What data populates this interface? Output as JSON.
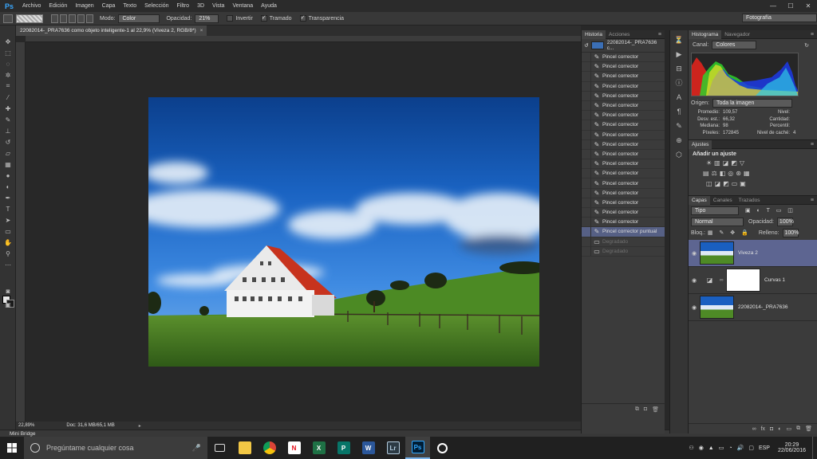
{
  "app": {
    "logo": "Ps"
  },
  "menu": [
    "Archivo",
    "Edición",
    "Imagen",
    "Capa",
    "Texto",
    "Selección",
    "Filtro",
    "3D",
    "Vista",
    "Ventana",
    "Ayuda"
  ],
  "options_bar": {
    "mode_label": "Modo:",
    "mode_value": "Color",
    "opacity_label": "Opacidad:",
    "opacity_value": "21%",
    "invert_label": "Invertir",
    "stroke_label": "Tramado",
    "transparency_label": "Transparencia",
    "workspace": "Fotografía"
  },
  "document": {
    "tab_title": "22082014-_PRA7636 como objeto inteligente-1 al 22,9% (Viveza 2, RGB/8*)",
    "zoom": "22,89%",
    "doc_size": "Doc: 31,6 MB/65,1 MB"
  },
  "mini_bridge": "Mini Bridge",
  "history": {
    "tabs": [
      "Historia",
      "Acciones"
    ],
    "snapshot": "22082014-_PRA7636 c...",
    "items": [
      {
        "label": "Pincel corrector",
        "state": "normal"
      },
      {
        "label": "Pincel corrector",
        "state": "normal"
      },
      {
        "label": "Pincel corrector",
        "state": "normal"
      },
      {
        "label": "Pincel corrector",
        "state": "normal"
      },
      {
        "label": "Pincel corrector",
        "state": "normal"
      },
      {
        "label": "Pincel corrector",
        "state": "normal"
      },
      {
        "label": "Pincel corrector",
        "state": "normal"
      },
      {
        "label": "Pincel corrector",
        "state": "normal"
      },
      {
        "label": "Pincel corrector",
        "state": "normal"
      },
      {
        "label": "Pincel corrector",
        "state": "normal"
      },
      {
        "label": "Pincel corrector",
        "state": "normal"
      },
      {
        "label": "Pincel corrector",
        "state": "normal"
      },
      {
        "label": "Pincel corrector",
        "state": "normal"
      },
      {
        "label": "Pincel corrector",
        "state": "normal"
      },
      {
        "label": "Pincel corrector",
        "state": "normal"
      },
      {
        "label": "Pincel corrector",
        "state": "normal"
      },
      {
        "label": "Pincel corrector",
        "state": "normal"
      },
      {
        "label": "Pincel corrector",
        "state": "normal"
      },
      {
        "label": "Pincel corrector puntual",
        "state": "selected"
      },
      {
        "label": "Degradado",
        "state": "dim"
      },
      {
        "label": "Degradado",
        "state": "dim"
      }
    ]
  },
  "histogram": {
    "tabs": [
      "Histograma",
      "Navegador"
    ],
    "channel_label": "Canal:",
    "channel_value": "Colores",
    "origin_label": "Origen:",
    "origin_value": "Toda la imagen",
    "stats_left": [
      {
        "label": "Promedio:",
        "value": "109,57"
      },
      {
        "label": "Desv. est.:",
        "value": "66,32"
      },
      {
        "label": "Mediana:",
        "value": "98"
      },
      {
        "label": "Píxeles:",
        "value": "172845"
      }
    ],
    "stats_right": [
      {
        "label": "Nivel:",
        "value": ""
      },
      {
        "label": "Cantidad:",
        "value": ""
      },
      {
        "label": "Percentil:",
        "value": ""
      },
      {
        "label": "Nivel de caché:",
        "value": "4"
      }
    ]
  },
  "adjustments": {
    "tab": "Ajustes",
    "title": "Añadir un ajuste"
  },
  "layers": {
    "tabs": [
      "Capas",
      "Canales",
      "Trazados"
    ],
    "filter": "Tipo",
    "blend_mode": "Normal",
    "opacity_label": "Opacidad:",
    "opacity_value": "100%",
    "lock_label": "Bloq.:",
    "fill_label": "Relleno:",
    "fill_value": "100%",
    "items": [
      {
        "name": "Viveza 2",
        "selected": true
      },
      {
        "name": "Curvas 1",
        "selected": false
      },
      {
        "name": "22082014-_PRA7636",
        "selected": false
      }
    ]
  },
  "taskbar": {
    "search_placeholder": "Pregúntame cualquier cosa",
    "language": "ESP",
    "time": "20:29",
    "date": "22/06/2016"
  }
}
